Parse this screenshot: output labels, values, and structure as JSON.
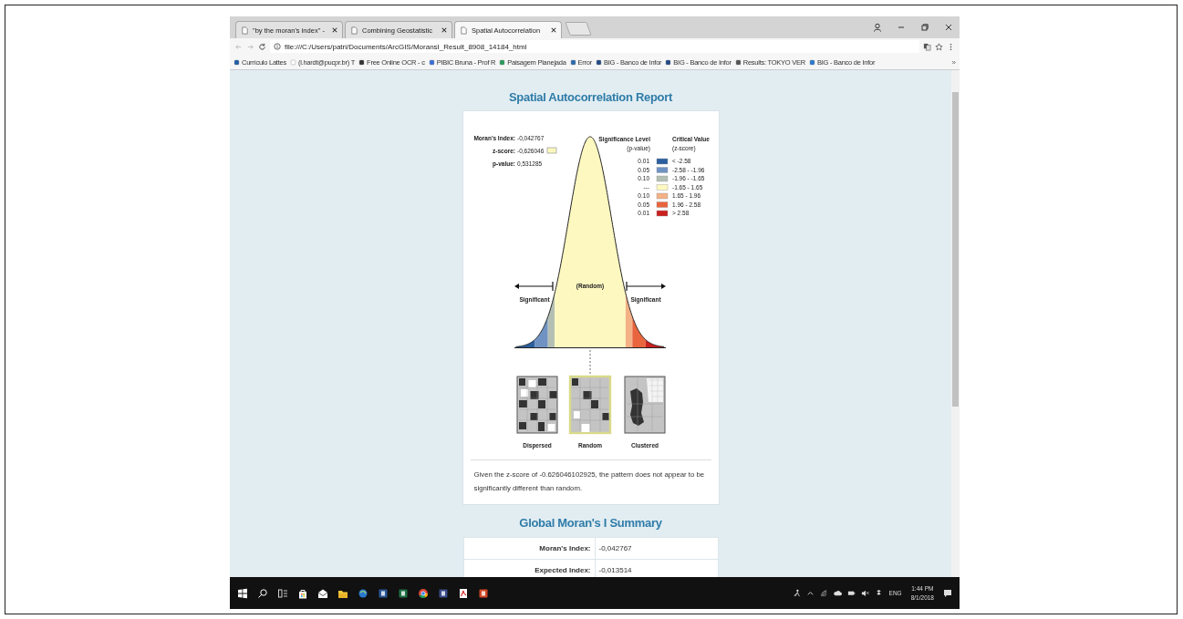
{
  "browser": {
    "tabs": [
      {
        "title": "\"by the moran's index\" -",
        "selected": false
      },
      {
        "title": "Combining Geostatistic",
        "selected": false
      },
      {
        "title": "Spatial Autocorrelation",
        "selected": true
      }
    ],
    "address": "file:///C:/Users/patri/Documents/ArcGIS/MoransI_Result_8908_14184_html",
    "bookmarks": [
      "Currículo Lattes",
      "(l.hardt@pucpr.br) T",
      "Free Online OCR - c",
      "PIBIC Bruna - Prof R",
      "Paisagem Planejada",
      "Error",
      "BIG - Banco de Infor",
      "BIG - Banco de Infor",
      "Results: TOKYO VER",
      "BIG - Banco de Infor"
    ],
    "bookmarks_more": "»"
  },
  "report": {
    "title": "Spatial Autocorrelation Report",
    "stats": [
      {
        "label": "Moran's Index:",
        "value": "-0,042767"
      },
      {
        "label": "z-score:",
        "value": "-0,626046"
      },
      {
        "label": "p-value:",
        "value": "0,531285"
      }
    ],
    "legend_headers": {
      "significance": [
        "Significance Level",
        "(p-value)"
      ],
      "critical": [
        "Critical Value",
        "(z-score)"
      ]
    },
    "legend": [
      {
        "p": "0.01",
        "range": "< -2.58",
        "color": "#2c5fa0"
      },
      {
        "p": "0.05",
        "range": "-2.58 - -1.96",
        "color": "#6f92c2"
      },
      {
        "p": "0.10",
        "range": "-1.96 - -1.65",
        "color": "#b4bfb3"
      },
      {
        "p": "---",
        "range": "-1.65 - 1.65",
        "color": "#fdf8c0"
      },
      {
        "p": "0.10",
        "range": "1.65 - 1.96",
        "color": "#f3b185"
      },
      {
        "p": "0.05",
        "range": "1.96 - 2.58",
        "color": "#e8653d"
      },
      {
        "p": "0.01",
        "range": "> 2.58",
        "color": "#c9211f"
      }
    ],
    "curve_labels": {
      "left": "Significant",
      "center": "(Random)",
      "right": "Significant"
    },
    "patterns": [
      {
        "kind": "dispersed",
        "label": "Dispersed",
        "selected": false
      },
      {
        "kind": "random",
        "label": "Random",
        "selected": true
      },
      {
        "kind": "clustered",
        "label": "Clustered",
        "selected": false
      }
    ],
    "conclusion": "Given the z-score of -0.626046102925, the pattern does not appear to be significantly different than random."
  },
  "summary": {
    "title": "Global Moran's I Summary",
    "rows": [
      {
        "label": "Moran's Index:",
        "value": "-0,042767"
      },
      {
        "label": "Expected Index:",
        "value": "-0,013514"
      }
    ]
  },
  "taskbar": {
    "language": "ENG",
    "time": "1:44 PM",
    "date": "8/1/2018"
  }
}
